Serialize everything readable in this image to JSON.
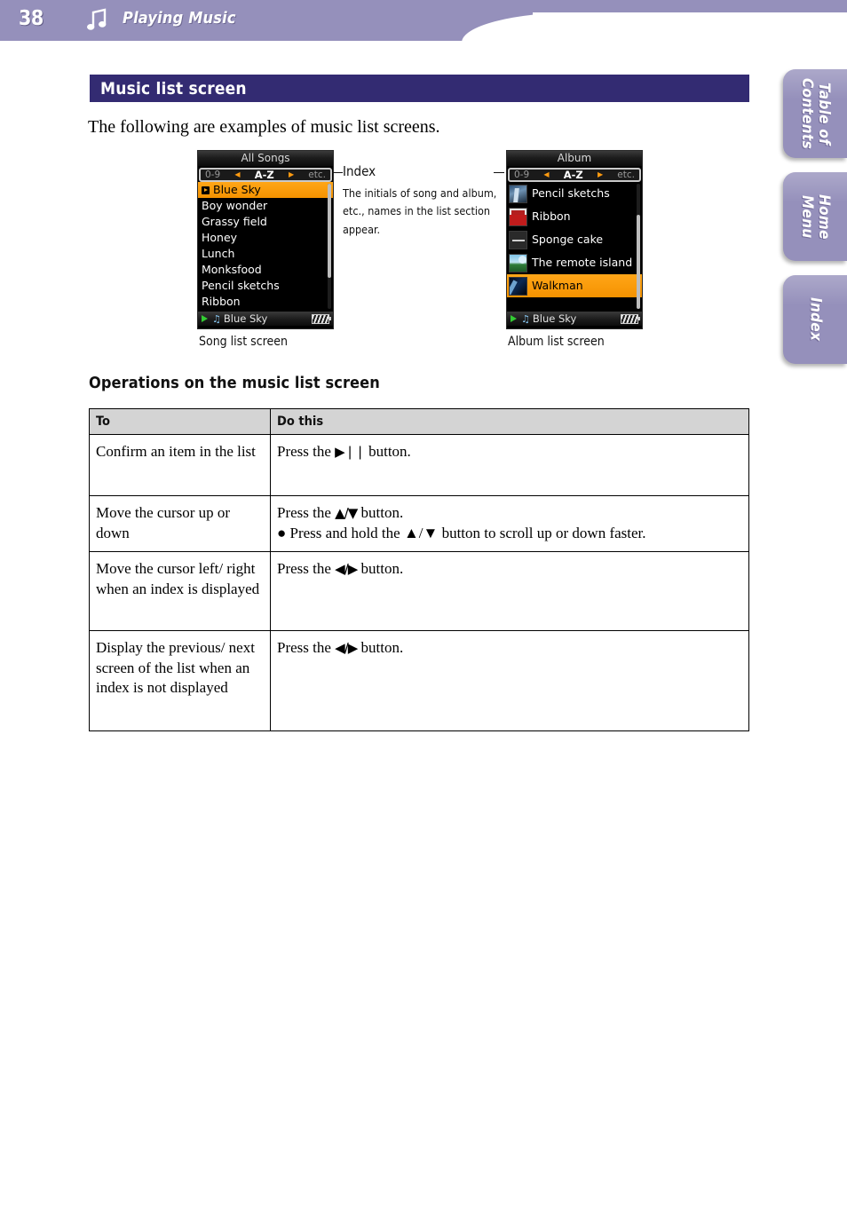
{
  "header": {
    "page_number": "38",
    "chapter_icon": "music-note-icon",
    "chapter_title": "Playing Music",
    "bar_color": "#9590bb"
  },
  "side_tabs": [
    {
      "id": "table-of-contents",
      "label": "Table of\nContents"
    },
    {
      "id": "home-menu",
      "label": "Home\nMenu"
    },
    {
      "id": "index",
      "label": "Index"
    }
  ],
  "section": {
    "title": "Music list screen",
    "title_bar_color": "#332b72",
    "intro": "The following are examples of music list screens."
  },
  "song_screen": {
    "title": "All Songs",
    "index_bar": {
      "left": "0-9",
      "center": "A-Z",
      "right": "etc."
    },
    "items": [
      {
        "label": "Blue Sky",
        "selected": true,
        "now_playing_mark": true
      },
      {
        "label": "Boy wonder",
        "selected": false
      },
      {
        "label": "Grassy field",
        "selected": false
      },
      {
        "label": "Honey",
        "selected": false
      },
      {
        "label": "Lunch",
        "selected": false
      },
      {
        "label": "Monksfood",
        "selected": false
      },
      {
        "label": "Pencil sketchs",
        "selected": false
      },
      {
        "label": "Ribbon",
        "selected": false
      }
    ],
    "status_bar": {
      "now_playing": "Blue Sky",
      "play_icon": "play-triangle-icon",
      "note_icon": "music-note-icon",
      "battery_icon": "battery-icon"
    },
    "caption": "Song list screen"
  },
  "album_screen": {
    "title": "Album",
    "index_bar": {
      "left": "0-9",
      "center": "A-Z",
      "right": "etc."
    },
    "items": [
      {
        "label": "Pencil sketchs",
        "selected": false,
        "thumb": "album-art-pencil-sketchs"
      },
      {
        "label": "Ribbon",
        "selected": false,
        "thumb": "album-art-ribbon"
      },
      {
        "label": "Sponge cake",
        "selected": false,
        "thumb": "album-art-sponge-cake"
      },
      {
        "label": "The remote island",
        "selected": false,
        "thumb": "album-art-remote-island"
      },
      {
        "label": "Walkman",
        "selected": true,
        "thumb": "album-art-walkman"
      }
    ],
    "status_bar": {
      "now_playing": "Blue Sky",
      "play_icon": "play-triangle-icon",
      "note_icon": "music-note-icon",
      "battery_icon": "battery-icon"
    },
    "caption": "Album list screen"
  },
  "callout": {
    "title": "Index",
    "body": "The initials of song and album, etc., names in the list section appear."
  },
  "operations": {
    "heading": "Operations on the music list screen",
    "columns": [
      "To",
      "Do this"
    ],
    "rows": [
      {
        "to": "Confirm an item in the list",
        "do_main": "Press the ▶▐▐ button.",
        "do_prefix": "Press the",
        "do_glyph": "▶❘❘",
        "do_suffix": "button.",
        "note": ""
      },
      {
        "to": "Move the cursor up or down",
        "do_prefix": "Press the",
        "do_glyph": "▲/▼",
        "do_suffix": "button.",
        "note": "● Press and hold the ▲/▼ button to scroll up or down faster."
      },
      {
        "to": "Move the cursor left/ right when an index is displayed",
        "do_prefix": "Press the",
        "do_glyph": "◀/▶",
        "do_suffix": "button.",
        "note": ""
      },
      {
        "to": "Display the previous/ next screen of the list when an index is not displayed",
        "do_prefix": "Press the",
        "do_glyph": "◀/▶",
        "do_suffix": "button.",
        "note": ""
      }
    ]
  }
}
